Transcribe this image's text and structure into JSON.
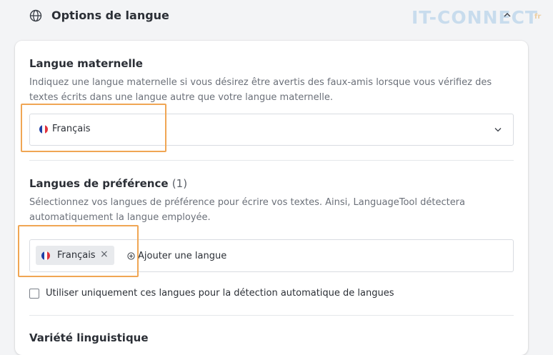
{
  "header": {
    "title": "Options de langue",
    "watermark": "IT-CONNECT",
    "watermark_suffix": "fr"
  },
  "mother_tongue": {
    "title": "Langue maternelle",
    "description": "Indiquez une langue maternelle si vous désirez être avertis des faux-amis lorsque vous vérifiez des textes écrits dans une langue autre que votre langue maternelle.",
    "selected": "Français"
  },
  "preferred_languages": {
    "title": "Langues de préférence",
    "count": "(1)",
    "description": "Sélectionnez vos langues de préférence pour écrire vos textes. Ainsi, LanguageTool détectera automatiquement la langue employée.",
    "chips": [
      {
        "label": "Français",
        "remove": "×"
      }
    ],
    "add_label": "Ajouter une langue"
  },
  "restrict_detection": {
    "label": "Utiliser uniquement ces langues pour la détection automatique de langues",
    "checked": false
  },
  "variety": {
    "title": "Variété linguistique"
  },
  "colors": {
    "highlight": "#f0a654",
    "flag_blue": "#1f3fa6",
    "flag_white": "#ffffff",
    "flag_red": "#e0323c"
  },
  "icons": [
    "globe-icon",
    "chevron-up-icon",
    "chevron-down-icon",
    "close-icon",
    "plus-circle-icon",
    "checkbox-icon"
  ]
}
